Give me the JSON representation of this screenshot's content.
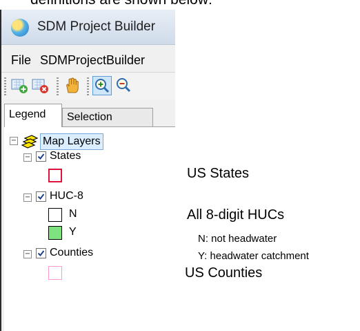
{
  "document": {
    "top_text": "definitions are shown below:",
    "descriptions": {
      "states": "US States",
      "huc8": "All 8-digit HUCs",
      "huc8_n": "N: not headwater",
      "huc8_y": "Y: headwater catchment",
      "counties": "US Counties"
    }
  },
  "window": {
    "title": "SDM Project Builder",
    "icon": "globe-icon"
  },
  "menu": {
    "file": "File",
    "builder": "SDMProjectBuilder"
  },
  "toolbar": {
    "buttons": [
      "add-layer-icon",
      "remove-layer-icon",
      "pan-hand-icon",
      "zoom-in-icon",
      "zoom-out-icon"
    ],
    "selected": "zoom-in-icon"
  },
  "tabs": {
    "legend": "Legend",
    "selection": "Selection",
    "active": "Legend"
  },
  "legend": {
    "group_label": "Map Layers",
    "layers": {
      "states": {
        "label": "States",
        "checked": true,
        "swatch_color": "#dc143c"
      },
      "huc8": {
        "label": "HUC-8",
        "checked": true,
        "n_label": "N",
        "y_label": "Y",
        "n_color": "#000000",
        "y_fill": "#7ee37e"
      },
      "counties": {
        "label": "Counties",
        "checked": true,
        "swatch_color": "#ff99cc"
      }
    }
  }
}
